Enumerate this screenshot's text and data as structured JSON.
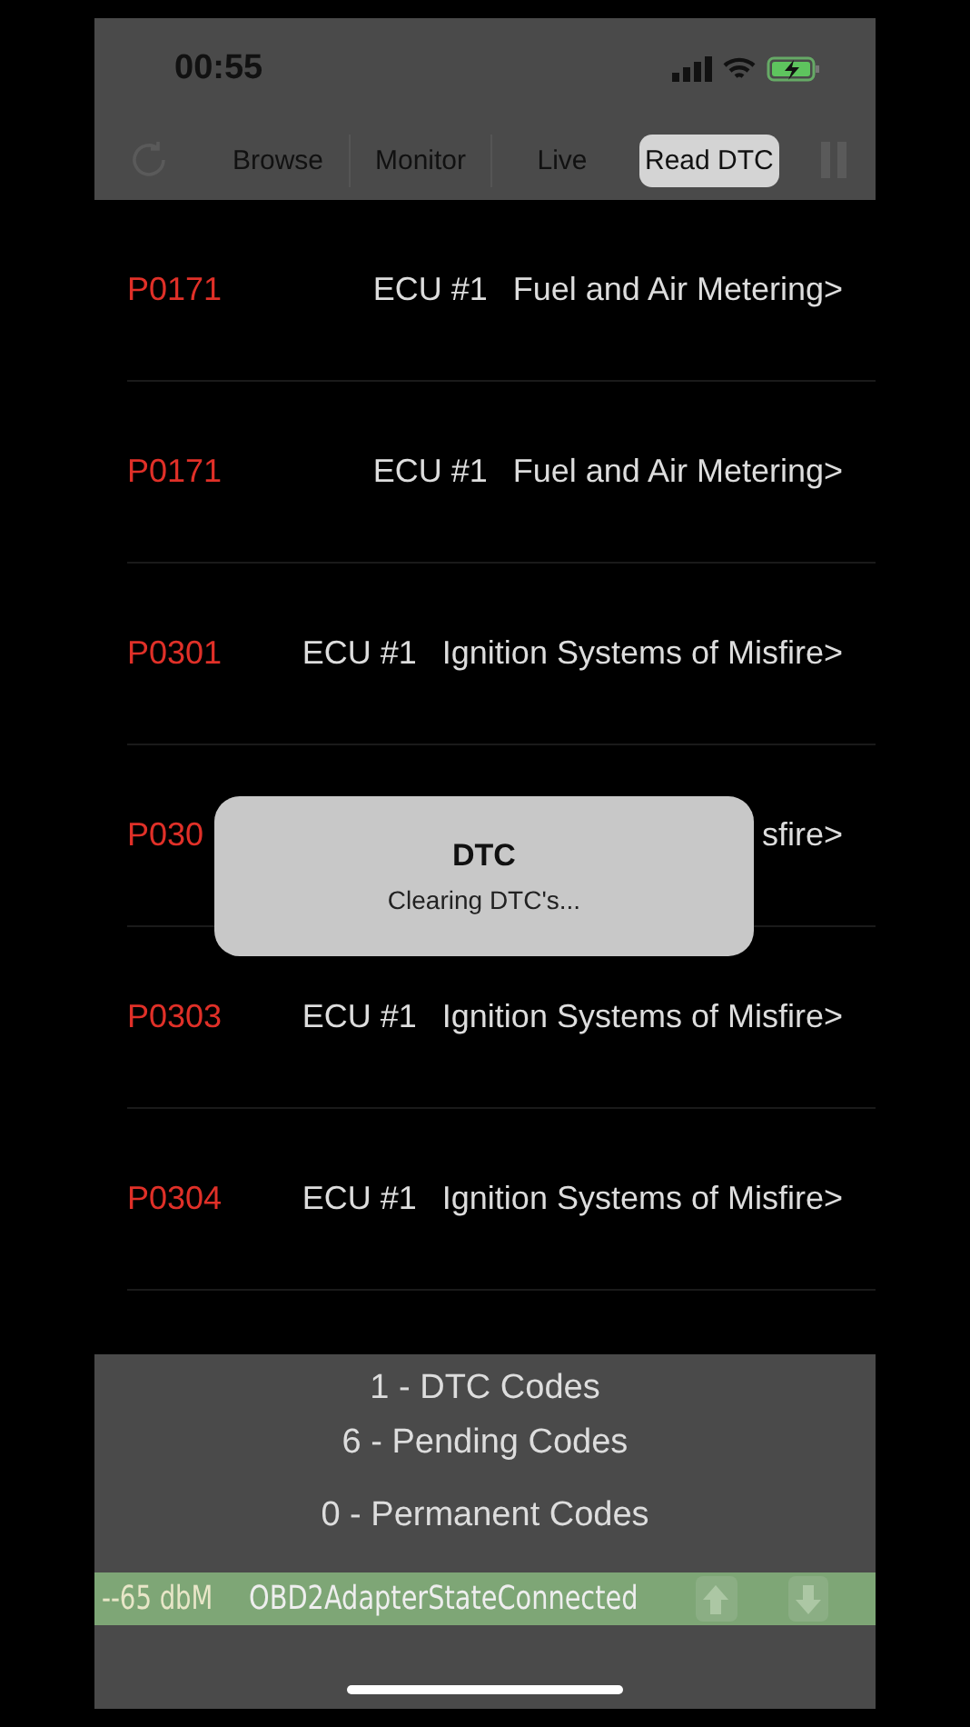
{
  "status_bar": {
    "time": "00:55"
  },
  "tabs": [
    {
      "label": "Browse",
      "selected": false
    },
    {
      "label": "Monitor",
      "selected": false
    },
    {
      "label": "Live",
      "selected": false
    },
    {
      "label": "Read DTC",
      "selected": true
    }
  ],
  "dtc_rows": [
    {
      "code": "P0171",
      "ecu": "ECU #1",
      "description": "Fuel and Air Metering>"
    },
    {
      "code": "P0171",
      "ecu": "ECU #1",
      "description": "Fuel and Air Metering>"
    },
    {
      "code": "P0301",
      "ecu": "ECU #1",
      "description": "Ignition Systems of Misfire>"
    },
    {
      "code": "P030",
      "description": "sfire>"
    },
    {
      "code": "P0303",
      "ecu": "ECU #1",
      "description": "Ignition Systems of Misfire>"
    },
    {
      "code": "P0304",
      "ecu": "ECU #1",
      "description": "Ignition Systems of Misfire>"
    }
  ],
  "alert": {
    "title": "DTC",
    "message": "Clearing DTC's..."
  },
  "summary": [
    "1 - DTC Codes",
    "6 - Pending Codes",
    "0 - Permanent Codes"
  ],
  "adapter_bar": {
    "signal": "--65 dbM",
    "state": "OBD2AdapterStateConnected"
  }
}
